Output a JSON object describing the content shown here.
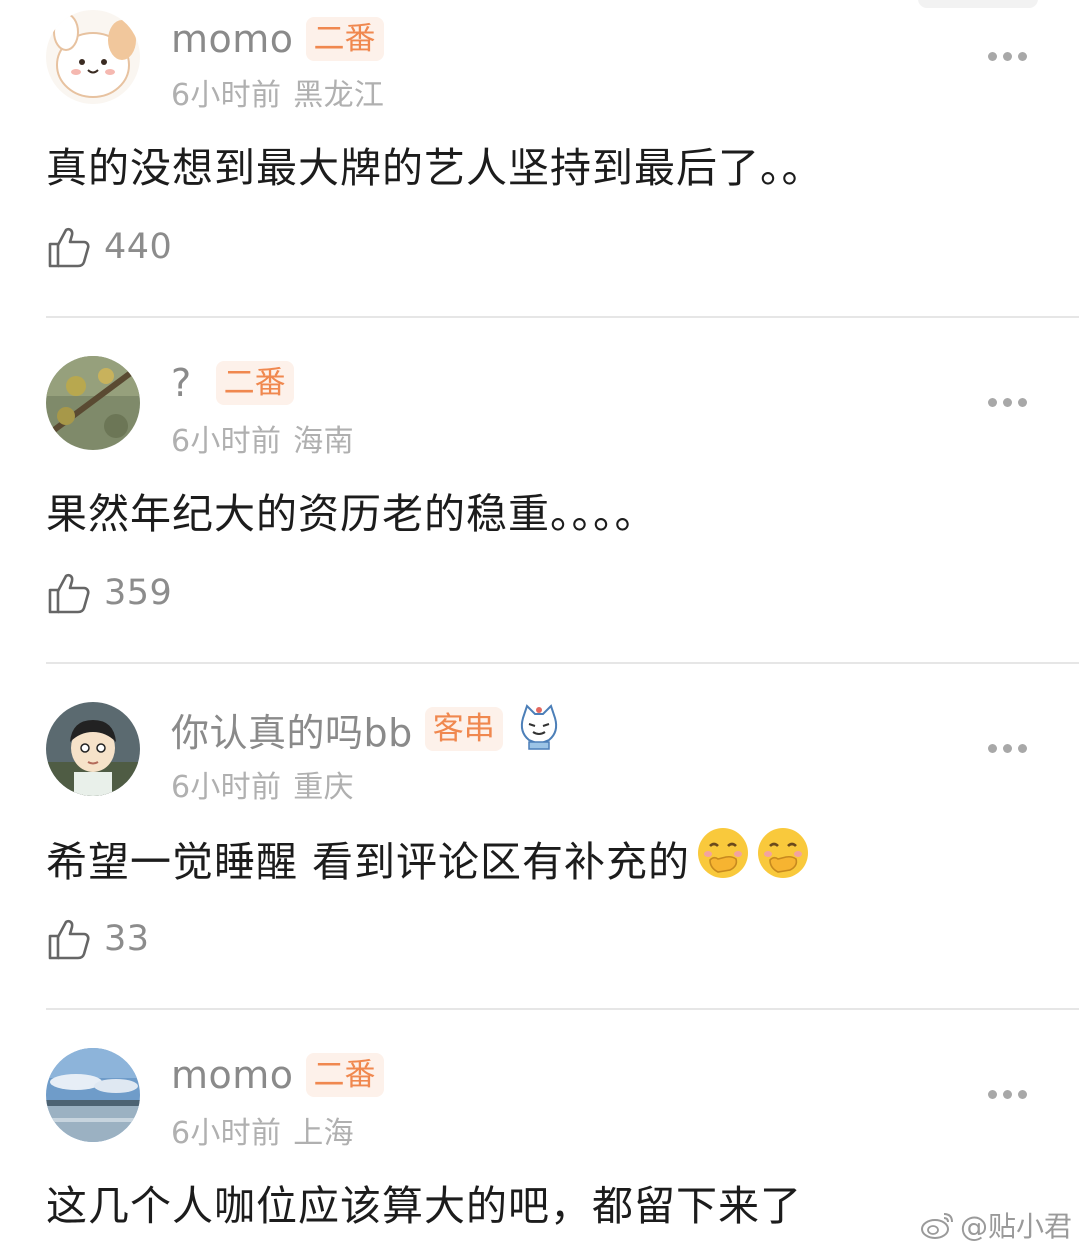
{
  "comments": [
    {
      "username": "momo",
      "badge": "二番",
      "time": "6小时前",
      "location": "黑龙江",
      "text": "真的没想到最大牌的艺人坚持到最后了。。",
      "likes": "440",
      "avatar_icon": "cartoon-bunny-avatar",
      "avatar_colors": {
        "bg": "#f8f4ef",
        "accent": "#e8a06a"
      }
    },
    {
      "username": "?",
      "badge": "二番",
      "time": "6小时前",
      "location": "海南",
      "text": "果然年纪大的资历老的稳重。。。。",
      "likes": "359",
      "avatar_icon": "plant-photo-avatar",
      "avatar_colors": {
        "bg": "#6f7c5a",
        "accent": "#c7b56a"
      }
    },
    {
      "username": "你认真的吗bb",
      "badge": "客串",
      "time": "6小时前",
      "location": "重庆",
      "text": "希望一觉睡醒 看到评论区有补充的",
      "likes": "33",
      "avatar_icon": "cartoon-boy-avatar",
      "avatar_colors": {
        "bg": "#5d6c74",
        "accent": "#f6e2c9"
      },
      "extra_icon": "cat-emoji-icon",
      "text_emojis": [
        "face-with-hand-over-mouth-emoji",
        "face-with-hand-over-mouth-emoji"
      ]
    },
    {
      "username": "momo",
      "badge": "二番",
      "time": "6小时前",
      "location": "上海",
      "text": "这几个人咖位应该算大的吧，都留下来了",
      "avatar_icon": "sky-photo-avatar",
      "avatar_colors": {
        "bg": "#7ea6cf",
        "accent": "#e7eef6"
      }
    }
  ],
  "watermark": {
    "icon": "weibo-icon",
    "text": "@贴小君"
  },
  "colors": {
    "badge_bg": "#fdf1ea",
    "badge_text": "#f0884f",
    "meta": "#b0b0b0",
    "divider": "#e6e6e6"
  }
}
